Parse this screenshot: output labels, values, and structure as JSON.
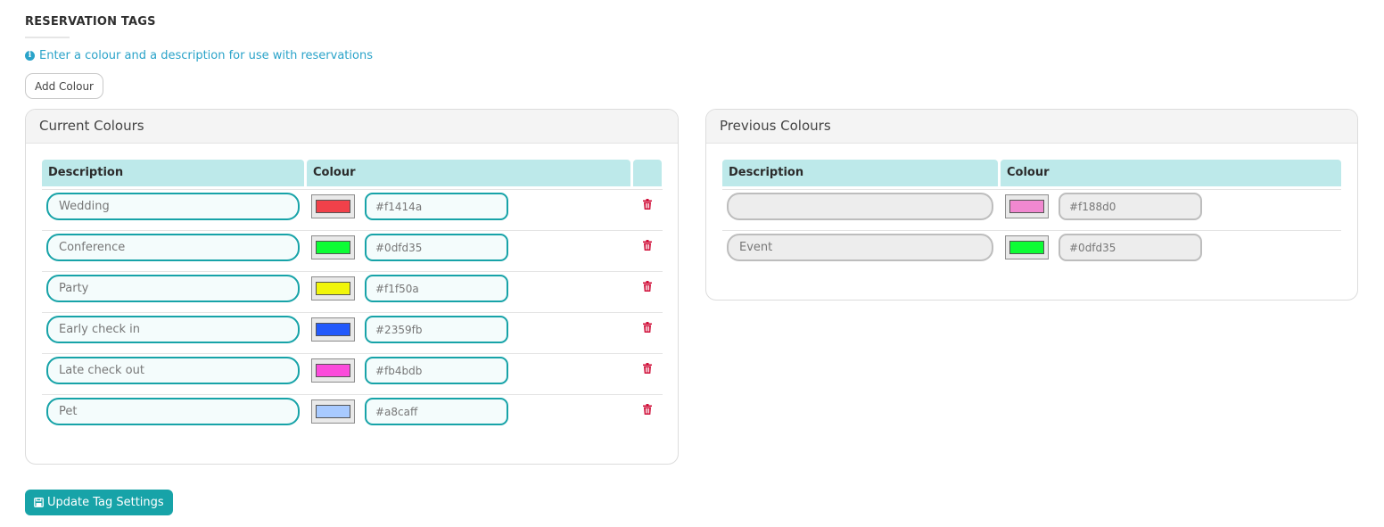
{
  "page": {
    "title": "RESERVATION TAGS",
    "info_text": "Enter a colour and a description for use with reservations",
    "add_button": "Add Colour",
    "save_button": "Update Tag Settings"
  },
  "current": {
    "heading": "Current Colours",
    "col_description": "Description",
    "col_colour": "Colour",
    "rows": [
      {
        "description": "Wedding",
        "hex": "#f1414a",
        "color": "#f1414a"
      },
      {
        "description": "Conference",
        "hex": "#0dfd35",
        "color": "#0dfd35"
      },
      {
        "description": "Party",
        "hex": "#f1f50a",
        "color": "#f1f50a"
      },
      {
        "description": "Early check in",
        "hex": "#2359fb",
        "color": "#2359fb"
      },
      {
        "description": "Late check out",
        "hex": "#fb4bdb",
        "color": "#fb4bdb"
      },
      {
        "description": "Pet",
        "hex": "#a8caff",
        "color": "#a8caff"
      }
    ]
  },
  "previous": {
    "heading": "Previous Colours",
    "col_description": "Description",
    "col_colour": "Colour",
    "rows": [
      {
        "description": "",
        "hex": "#f188d0",
        "color": "#f188d0"
      },
      {
        "description": "Event",
        "hex": "#0dfd35",
        "color": "#0dfd35"
      }
    ]
  },
  "colors": {
    "accent": "#17a3a8",
    "header_bg": "#bde9ea",
    "info": "#2aa3c9",
    "delete": "#d0103a"
  }
}
